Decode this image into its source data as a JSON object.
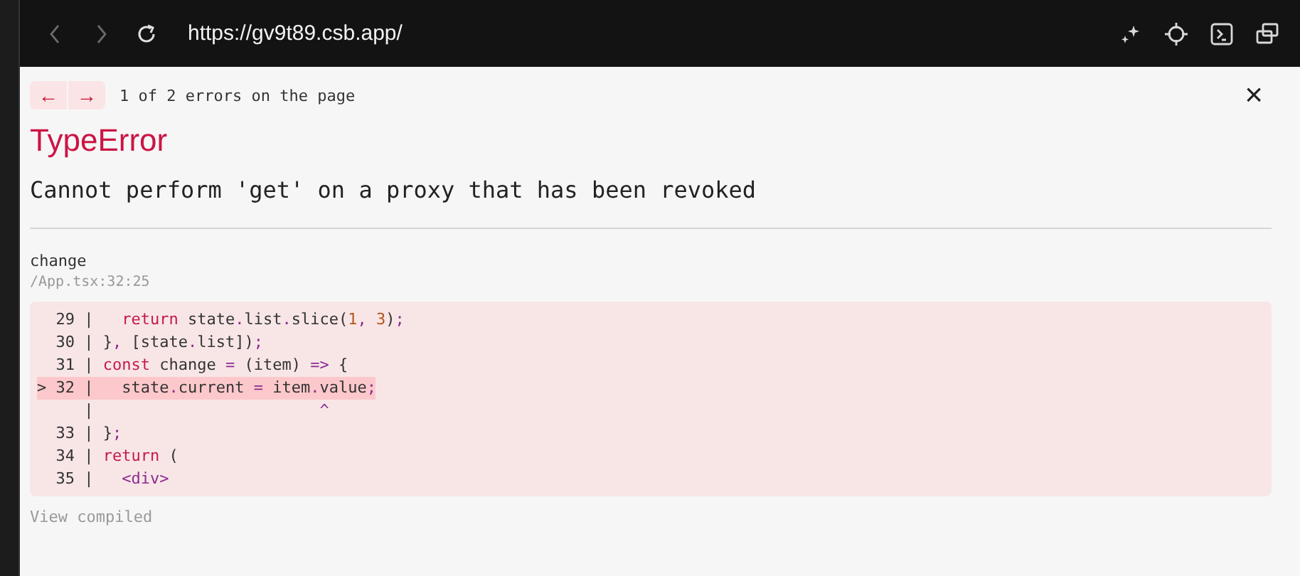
{
  "browser": {
    "url": "https://gv9t89.csb.app/"
  },
  "error_overlay": {
    "nav_buttons": [
      "←",
      "→"
    ],
    "counter": "1 of 2 errors on the page",
    "close": "×",
    "title": "TypeError",
    "message": "Cannot perform 'get' on a proxy that has been revoked",
    "frame": {
      "function": "change",
      "location": "/App.tsx:32:25"
    },
    "code_lines": [
      {
        "gutter": "  29 |",
        "highlighted": false,
        "tokens": [
          {
            "kind": "keyword",
            "text": "   return"
          },
          {
            "kind": "plain",
            "text": " state"
          },
          {
            "kind": "punct",
            "text": "."
          },
          {
            "kind": "plain",
            "text": "list"
          },
          {
            "kind": "punct",
            "text": "."
          },
          {
            "kind": "plain",
            "text": "slice("
          },
          {
            "kind": "number",
            "text": "1"
          },
          {
            "kind": "punct",
            "text": ", "
          },
          {
            "kind": "number",
            "text": "3"
          },
          {
            "kind": "plain",
            "text": ")"
          },
          {
            "kind": "punct",
            "text": ";"
          }
        ]
      },
      {
        "gutter": "  30 |",
        "highlighted": false,
        "tokens": [
          {
            "kind": "plain",
            "text": " }"
          },
          {
            "kind": "punct",
            "text": ", "
          },
          {
            "kind": "plain",
            "text": "[state"
          },
          {
            "kind": "punct",
            "text": "."
          },
          {
            "kind": "plain",
            "text": "list])"
          },
          {
            "kind": "punct",
            "text": ";"
          }
        ]
      },
      {
        "gutter": "  31 |",
        "highlighted": false,
        "tokens": [
          {
            "kind": "keyword",
            "text": " const"
          },
          {
            "kind": "plain",
            "text": " change "
          },
          {
            "kind": "punct",
            "text": "="
          },
          {
            "kind": "plain",
            "text": " (item) "
          },
          {
            "kind": "punct",
            "text": "=>"
          },
          {
            "kind": "plain",
            "text": " {"
          }
        ]
      },
      {
        "gutter": "> 32 |",
        "highlighted": true,
        "tokens": [
          {
            "kind": "plain",
            "text": "   state"
          },
          {
            "kind": "punct",
            "text": "."
          },
          {
            "kind": "plain",
            "text": "current "
          },
          {
            "kind": "punct",
            "text": "="
          },
          {
            "kind": "plain",
            "text": " item"
          },
          {
            "kind": "punct",
            "text": "."
          },
          {
            "kind": "plain",
            "text": "value"
          },
          {
            "kind": "punct",
            "text": ";"
          }
        ]
      },
      {
        "gutter": "     |",
        "highlighted": false,
        "tokens": [
          {
            "kind": "caret",
            "text": "                        ^"
          }
        ]
      },
      {
        "gutter": "  33 |",
        "highlighted": false,
        "tokens": [
          {
            "kind": "plain",
            "text": " }"
          },
          {
            "kind": "punct",
            "text": ";"
          }
        ]
      },
      {
        "gutter": "  34 |",
        "highlighted": false,
        "tokens": [
          {
            "kind": "keyword",
            "text": " return"
          },
          {
            "kind": "plain",
            "text": " ("
          }
        ]
      },
      {
        "gutter": "  35 |",
        "highlighted": false,
        "tokens": [
          {
            "kind": "tag",
            "text": "   <div>"
          }
        ]
      }
    ],
    "view_compiled": "View compiled"
  }
}
